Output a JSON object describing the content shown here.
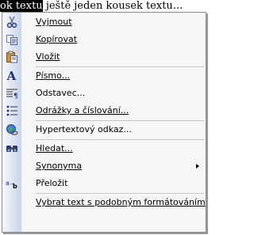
{
  "document": {
    "selected_text": "ok textu",
    "trailing_text": " ještě jeden kousek textu..."
  },
  "menu": {
    "items": [
      {
        "label": "Vyjmout",
        "icon": "scissors-icon"
      },
      {
        "label": "Kopírovat",
        "icon": "copy-icon"
      },
      {
        "label": "Vložit",
        "icon": "paste-icon"
      },
      {
        "label": "Písmo...",
        "icon": "font-icon"
      },
      {
        "label": "Odstavec...",
        "icon": "paragraph-icon"
      },
      {
        "label": "Odrážky a číslování...",
        "icon": "bullets-icon"
      },
      {
        "label": "Hypertextový odkaz...",
        "icon": "hyperlink-icon"
      },
      {
        "label": "Hledat...",
        "icon": "search-icon"
      },
      {
        "label": "Synonyma",
        "icon": "",
        "submenu": true
      },
      {
        "label": "Přeložit",
        "icon": "translate-icon"
      },
      {
        "label": "Vybrat text s podobným formátováním",
        "icon": ""
      }
    ]
  }
}
